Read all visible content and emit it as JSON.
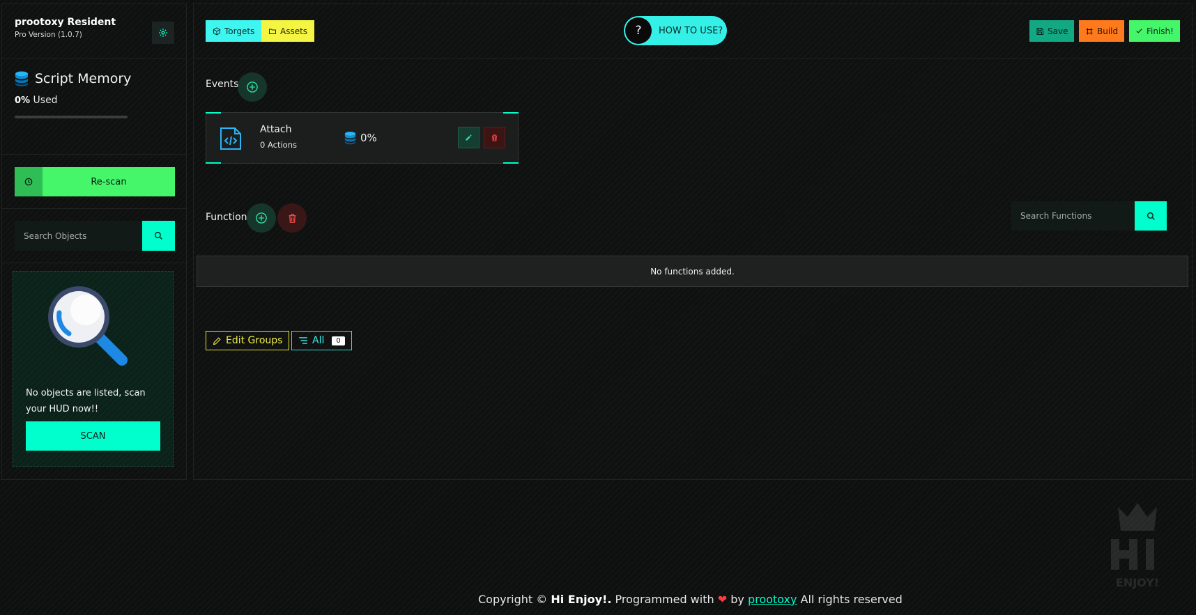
{
  "sidebar": {
    "app_name": "prootoxy Resident",
    "app_version": "Pro Version (1.0.7)",
    "memory_title": "Script Memory",
    "memory_percent": "0%",
    "memory_used_label": "Used",
    "memory_fraction": 0,
    "rescan_label": "Re-scan",
    "search_placeholder": "Search Objects",
    "empty_text": "No objects are listed, scan your HUD now!!",
    "scan_label": "SCAN"
  },
  "topbar": {
    "targets_label": "Torgets",
    "assets_label": "Assets",
    "howto_q": "?",
    "howto_label": "HOW TO USE?",
    "save_label": "Save",
    "build_label": "Build",
    "finish_label": "Finish!"
  },
  "events": {
    "label": "Events",
    "items": [
      {
        "name": "Attach",
        "actions": "0 Actions",
        "memory": "0%"
      }
    ]
  },
  "functions": {
    "label": "Functions",
    "search_placeholder": "Search Functions",
    "empty_text": "No functions added."
  },
  "groups": {
    "edit_label": "Edit Groups",
    "all_label": "All",
    "all_count": "0"
  },
  "footer": {
    "copyright": "Copyright ©",
    "brand": "Hi Enjoy!.",
    "programmed_with": "Programmed with",
    "by": "by",
    "author": "prootoxy",
    "rights": "All rights reserved"
  },
  "watermark": {
    "text_top": "HI",
    "text_bottom": "ENJOY!"
  },
  "colors": {
    "accent": "#00ffcc",
    "green": "#45f56a",
    "yellow": "#f3f542",
    "cyan": "#3ff5f0",
    "orange": "#ff7a1c",
    "danger": "#ff3b3b"
  }
}
